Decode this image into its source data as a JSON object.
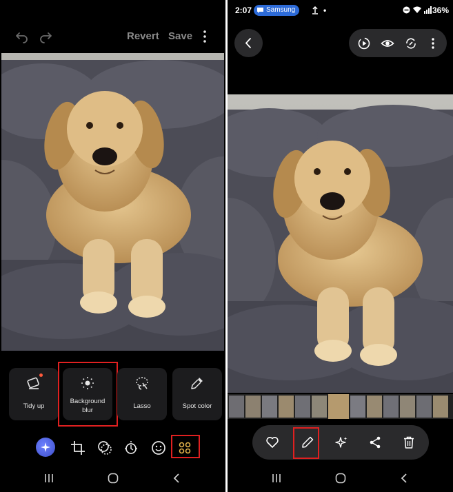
{
  "editor": {
    "revert_label": "Revert",
    "save_label": "Save",
    "tools": [
      {
        "label": "Tidy up",
        "icon": "eraser-icon"
      },
      {
        "label_line1": "Background",
        "label_line2": "blur",
        "icon": "blur-icon"
      },
      {
        "label": "Lasso",
        "icon": "lasso-icon"
      },
      {
        "label": "Spot color",
        "icon": "dropper-icon"
      }
    ],
    "bottom_icons": [
      "ai-sparkle-icon",
      "crop-rotate-icon",
      "filter-icon",
      "brightness-icon",
      "sticker-icon",
      "more-tools-icon"
    ]
  },
  "viewer": {
    "status": {
      "time": "2:07",
      "chip_label": "Samsung",
      "notif_dot": "•",
      "battery": "36%"
    },
    "top_icons": [
      "motion-play-icon",
      "eye-icon",
      "revitalize-icon",
      "more-icon"
    ],
    "actions": [
      "heart-icon",
      "edit-pencil-icon",
      "ai-sparkle-icon",
      "share-icon",
      "trash-icon"
    ]
  },
  "colors": {
    "highlight": "#e02020",
    "ai_button": "#4a5de0",
    "chip": "#2d6bd8"
  }
}
